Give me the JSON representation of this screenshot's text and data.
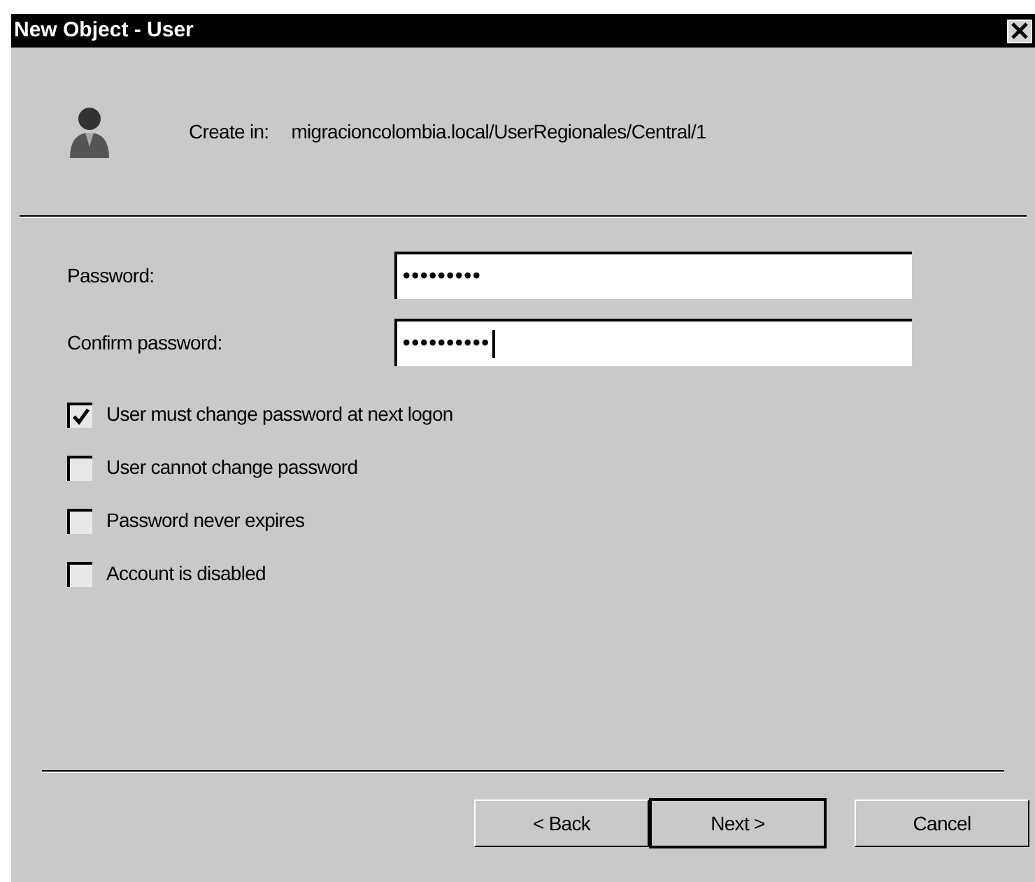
{
  "window": {
    "title": "New Object - User"
  },
  "create_in": {
    "label": "Create in:",
    "path": "migracioncolombia.local/UserRegionales/Central/1"
  },
  "fields": [
    {
      "label": "Password:",
      "value": "•••••••••",
      "focused": false
    },
    {
      "label": "Confirm password:",
      "value": "••••••••••",
      "focused": true
    }
  ],
  "options": [
    {
      "label": "User must change password at next logon",
      "checked": true
    },
    {
      "label": "User cannot change password",
      "checked": false
    },
    {
      "label": "Password never expires",
      "checked": false
    },
    {
      "label": "Account is disabled",
      "checked": false
    }
  ],
  "buttons": [
    {
      "label": "< Back",
      "default": false
    },
    {
      "label": "Next >",
      "default": true
    },
    {
      "label": "Cancel",
      "default": false
    }
  ]
}
